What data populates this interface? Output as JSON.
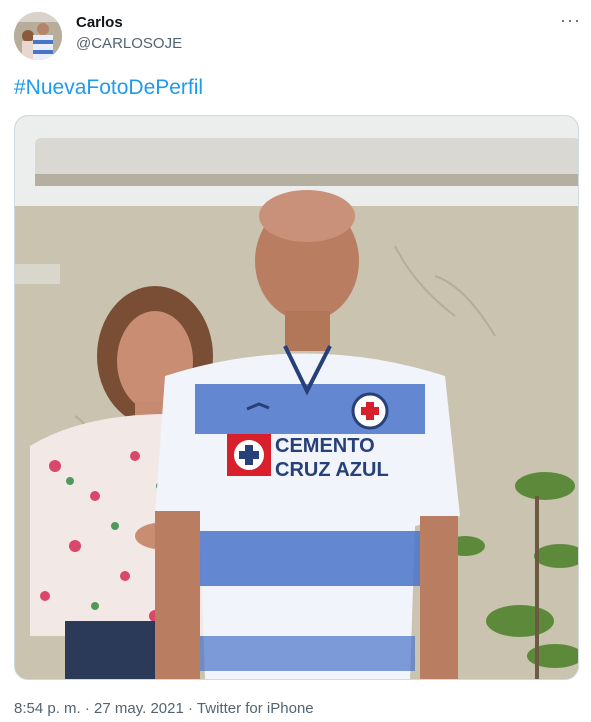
{
  "tweet": {
    "author_name": "Carlos",
    "author_handle": "@CARLOSOJE",
    "more_icon": "···",
    "hashtag": "#NuevaFotoDePerfil",
    "time": "8:54 p. m.",
    "separator": "·",
    "date": "27 may. 2021",
    "source": "Twitter for iPhone"
  },
  "photo": {
    "jersey_text_line1": "CEMENTO",
    "jersey_text_line2": "CRUZ AZUL"
  },
  "colors": {
    "link": "#1d9bf0",
    "secondary_text": "#536471",
    "jersey_blue": "#3f6bc6",
    "jersey_red": "#d7202b"
  }
}
